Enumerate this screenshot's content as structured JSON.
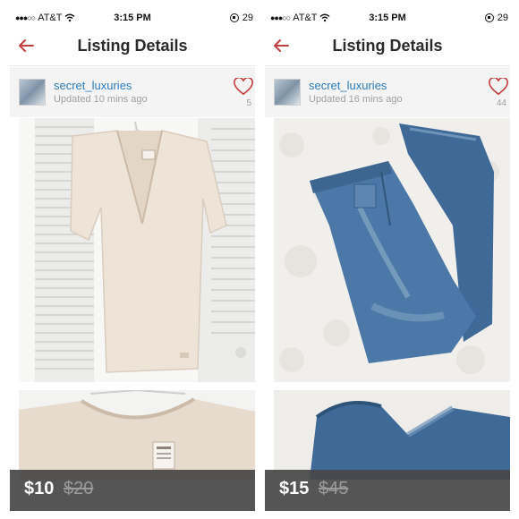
{
  "panels": [
    {
      "status": {
        "carrier": "AT&T",
        "time": "3:15 PM",
        "battery": "29"
      },
      "nav": {
        "title": "Listing Details"
      },
      "seller": {
        "name": "secret_luxuries",
        "updated": "Updated 10 mins ago",
        "likes": "5"
      },
      "photo": {
        "main": "cream v-neck t-shirt on hanger against white louvered door",
        "thumb": "close-up of shirt collar with PINK tag"
      },
      "price": {
        "current": "$10",
        "original": "$20"
      }
    },
    {
      "status": {
        "carrier": "AT&T",
        "time": "3:15 PM",
        "battery": "29"
      },
      "nav": {
        "title": "Listing Details"
      },
      "seller": {
        "name": "secret_luxuries",
        "updated": "Updated 16 mins ago",
        "likes": "44"
      },
      "photo": {
        "main": "folded blue denim jeans on white fluffy rug",
        "thumb": "close-up of jeans cuff on white rug"
      },
      "price": {
        "current": "$15",
        "original": "$45"
      }
    }
  ],
  "colors": {
    "accent": "#c0403f",
    "seller_link": "#2b7cc2",
    "price_bar": "#464646"
  }
}
